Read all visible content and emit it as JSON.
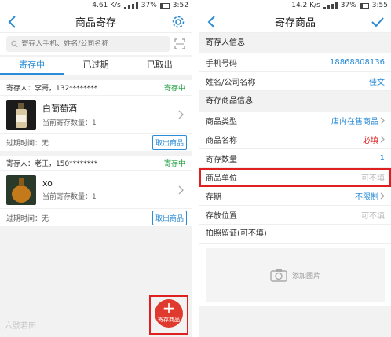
{
  "left": {
    "status": {
      "speed": "4.61 K/s",
      "battery": "37%",
      "time": "3:52"
    },
    "nav": {
      "title": "商品寄存"
    },
    "search": {
      "placeholder": "寄存人手机、姓名/公司名称"
    },
    "tabs": [
      {
        "label": "寄存中",
        "active": true
      },
      {
        "label": "已过期",
        "active": false
      },
      {
        "label": "已取出",
        "active": false
      }
    ],
    "cards": [
      {
        "depositor": "寄存人：李哥，132********",
        "status": "寄存中",
        "product": "白葡萄酒",
        "qty": "当前寄存数量：1",
        "expire": "过期时间：无",
        "action": "取出商品"
      },
      {
        "depositor": "寄存人：老王，150********",
        "status": "寄存中",
        "product": "xo",
        "qty": "当前寄存数量：1",
        "expire": "过期时间：无",
        "action": "取出商品"
      }
    ],
    "fab": {
      "label": "寄存商品"
    },
    "watermark": "六號若田"
  },
  "right": {
    "status": {
      "speed": "14.2 K/s",
      "battery": "37%",
      "time": "3:55"
    },
    "nav": {
      "title": "寄存商品"
    },
    "section1": "寄存人信息",
    "phone": {
      "label": "手机号码",
      "value": "18868808136"
    },
    "name": {
      "label": "姓名/公司名称",
      "value": "佳文"
    },
    "section2": "寄存商品信息",
    "type": {
      "label": "商品类型",
      "value": "店内在售商品"
    },
    "product_name": {
      "label": "商品名称",
      "value": "必填"
    },
    "quantity": {
      "label": "寄存数量",
      "value": "1"
    },
    "unit": {
      "label": "商品单位",
      "placeholder": "可不填"
    },
    "period": {
      "label": "存期",
      "value": "不限制"
    },
    "location": {
      "label": "存放位置",
      "placeholder": "可不填"
    },
    "photo": {
      "label": "拍照留证(可不填)",
      "add": "添加图片"
    }
  },
  "colors": {
    "accent": "#2a8bd6",
    "green": "#1a9b3c",
    "red": "#e02020"
  }
}
